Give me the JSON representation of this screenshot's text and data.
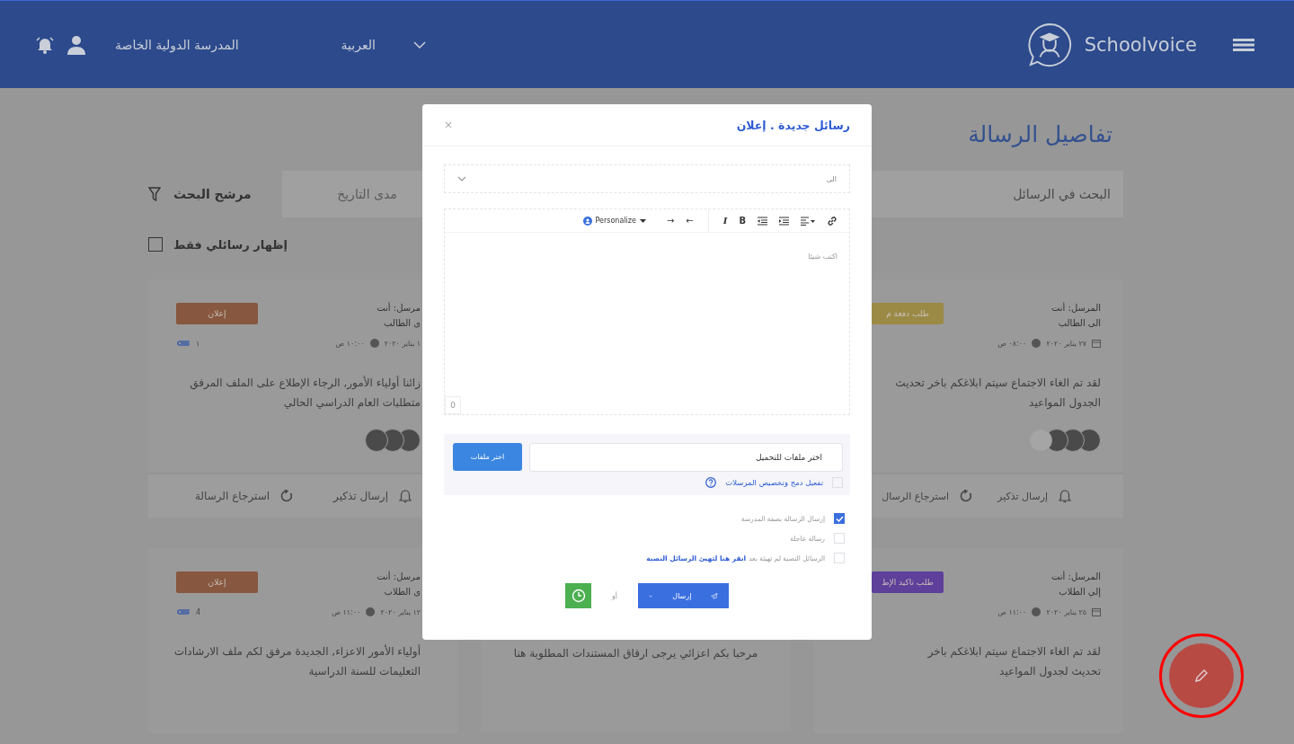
{
  "header": {
    "brand": "Schoolvoice",
    "school": "المدرسة الدولية الخاصة",
    "language": "العربية"
  },
  "page_title": "تفاصيل الرسالة",
  "filters": {
    "search_placeholder": "البحث في الرسائل",
    "date_placeholder": "مدى التاريخ",
    "filter_label": "مرشح البحث",
    "only_mine": {
      "label": "إظهار رسائلي فقط",
      "checked": false
    }
  },
  "left_cards": [
    {
      "badge": {
        "text": "إعلان",
        "color": "#87573f"
      },
      "sender": "مرسل: أنت",
      "recipient": "ى الطالب",
      "date": "١ يناير ٢٠٢٠",
      "time": "١٠:٠٠ ص",
      "attachments": "١",
      "body": [
        "زائنا أولياء الأمور, الرجاء الإطلاع على الملف المرفق",
        "متطلبات العام الدراسي الحالي"
      ],
      "avatars": true,
      "actions": [
        {
          "kind": "remind",
          "label": "إرسال تذكير"
        },
        {
          "kind": "recall",
          "label": "استرجاع الرسالة"
        }
      ]
    },
    {
      "badge": {
        "text": "إعلان",
        "color": "#87573f"
      },
      "sender": "مرسل: أنت",
      "recipient": "ى الطلاب",
      "date": "١٢ يناير ٢٠٢٠",
      "time": "١١:٠٠ ص",
      "attachments": "4",
      "body": [
        "أولياء الأمور الاعزاء, الجديدة  مرفق لكم ملف الارشادات",
        "التعليمات للسنة الدراسية"
      ]
    }
  ],
  "middle_card": {
    "body": [
      "مرحبا بكم اعزائي يرجى ارفاق المستندات المطلوبة هنا"
    ]
  },
  "right_cards": [
    {
      "badge": {
        "text": "طلب دفعة م",
        "color": "#9a8a45"
      },
      "sender": "المرسل: أنت",
      "recipient": "الى الطالب",
      "date": "٢٧ يناير ٢٠٢٠",
      "calendar_icon": true,
      "time": "٠٨:٠٠ ص",
      "body": [
        "لقد تم الغاء الاجتماع سيتم ابلاغكم باخر تحديث",
        "الجدول المواعيد"
      ],
      "avatars": true,
      "actions": [
        {
          "kind": "remind",
          "label": "إرسال تذكير"
        },
        {
          "kind": "recall",
          "label": "استرجاع الرسال"
        }
      ]
    },
    {
      "badge": {
        "text": "طلب تاكيد الإط",
        "color": "#5e3f9a"
      },
      "sender": "المرسل: أنت",
      "recipient": "إلي الطلاب",
      "date": "٢٥ يناير ٢٠٢٠",
      "calendar_icon": true,
      "time": "١١:٠٠ ص",
      "body": [
        "لقد تم الغاء الاجتماع سيتم ابلاغكم باخر",
        "تحديث لجدول المواعيد"
      ]
    }
  ],
  "modal": {
    "title": "رسائل جديدة . إعلان",
    "close": "×",
    "to_placeholder": "الى",
    "toolbar": [
      {
        "kind": "link"
      },
      {
        "kind": "align"
      },
      {
        "kind": "indent"
      },
      {
        "kind": "outdent"
      },
      {
        "kind": "bold",
        "label": "B"
      },
      {
        "kind": "italic",
        "label": "I"
      },
      {
        "kind": "divider"
      },
      {
        "kind": "arrow",
        "label": "←"
      },
      {
        "kind": "arrow",
        "label": "→"
      },
      {
        "kind": "personalize",
        "label": "Personalize"
      }
    ],
    "editor_placeholder": "اكتب شيئا",
    "char_count": "0",
    "upload": {
      "placeholder": "اختر ملفات للتحميل",
      "button": "اختر ملفات",
      "merge": {
        "label": "تفعيل دمج وتخصيص المرسلات",
        "checked": false
      }
    },
    "options": [
      {
        "label": "إرسال الرسالة بصفة المدرسة",
        "checked": true
      },
      {
        "label": "رسالة عاجلة",
        "checked": false
      },
      {
        "label": "الرسائل النصية لم تهيئة بعد",
        "link": "انقر هنا لتهيئ الرسائل النصية",
        "checked": false
      }
    ],
    "send": "إرسال",
    "or": "أو"
  }
}
